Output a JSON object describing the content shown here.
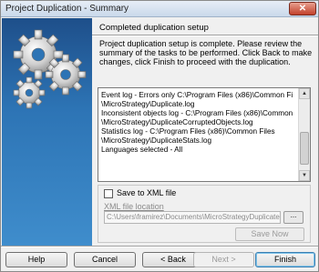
{
  "window": {
    "title": "Project Duplication - Summary",
    "close_label": "✕"
  },
  "content": {
    "heading": "Completed duplication setup",
    "description": "Project duplication setup is complete.  Please review the  summary of the tasks to be performed. Click Back to make changes, click Finish to proceed with the duplication.",
    "summary_lines": [
      "Event log - Errors only C:\\Program Files (x86)\\Common Files",
      "\\MicroStrategy\\Duplicate.log",
      "Inconsistent objects log - C:\\Program Files (x86)\\Common Files",
      "\\MicroStrategy\\DuplicateCorruptedObjects.log",
      "Statistics log - C:\\Program Files (x86)\\Common Files",
      "\\MicroStrategy\\DuplicateStats.log",
      "Languages selected - All"
    ]
  },
  "xml": {
    "checkbox_label": "Save to XML file",
    "checked": false,
    "file_label": "XML file location",
    "file_value": "C:\\Users\\framirez\\Documents\\MicroStrategyDuplicate.xml",
    "browse_label": "...",
    "save_now_label": "Save Now"
  },
  "buttons": {
    "help": "Help",
    "cancel": "Cancel",
    "back": "< Back",
    "next": "Next >",
    "finish": "Finish"
  },
  "colors": {
    "art_gradient_top": "#1e4f8a",
    "art_gradient_bottom": "#3f8dcc",
    "gear_color": "#dcdcdc"
  }
}
